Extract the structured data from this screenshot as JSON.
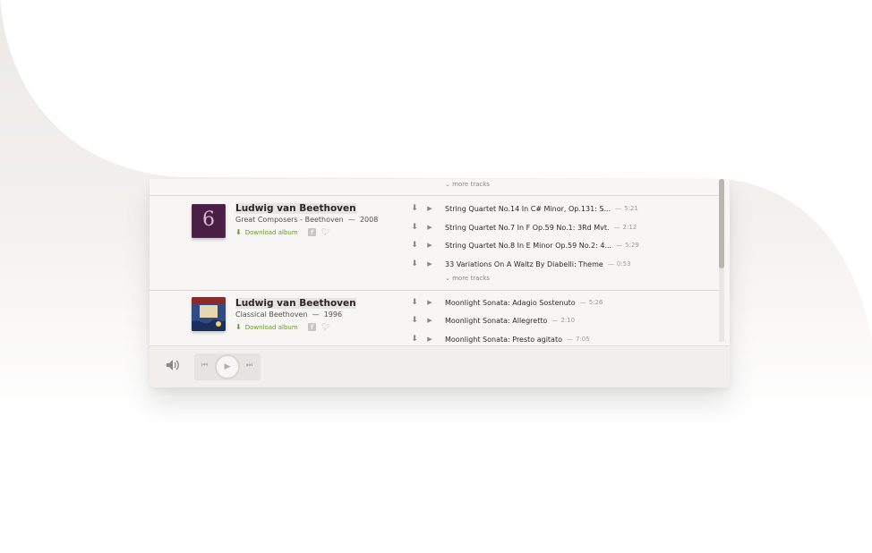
{
  "first_more_tracks": "more tracks",
  "albums": [
    {
      "artist": "Ludwig van Beethoven",
      "collection": "Great Composers - Beethoven",
      "separator": "—",
      "year": "2008",
      "cover_label": "6",
      "download_label": "Download album",
      "more_tracks": "more tracks",
      "tracks": [
        {
          "title": "String Quartet No.14 In C# Minor, Op.131: S...",
          "sep": "—",
          "duration": "5:21"
        },
        {
          "title": "String Quartet No.7 In F Op.59 No.1: 3Rd Mvt.",
          "sep": "—",
          "duration": "2:12"
        },
        {
          "title": "String Quartet No.8 In E Minor Op.59 No.2: 4...",
          "sep": "—",
          "duration": "5:29"
        },
        {
          "title": "33 Variations On A Waltz By Diabelli: Theme",
          "sep": "—",
          "duration": "0:53"
        }
      ]
    },
    {
      "artist": "Ludwig van Beethoven",
      "collection": "Classical Beethoven",
      "separator": "—",
      "year": "1996",
      "download_label": "Download album",
      "tracks": [
        {
          "title": "Moonlight Sonata: Adagio Sostenuto",
          "sep": "—",
          "duration": "5:26"
        },
        {
          "title": "Moonlight Sonata: Allegretto",
          "sep": "—",
          "duration": "2:10"
        },
        {
          "title": "Moonlight Sonata: Presto agitato",
          "sep": "—",
          "duration": "7:05"
        }
      ]
    }
  ],
  "icons": {
    "chevron": "⌄",
    "download": "⬇",
    "play": "▶",
    "prev": "⏮",
    "next": "⏭",
    "volume": "🔊"
  },
  "colors": {
    "accent_green": "#6a9a2e",
    "cover_purple": "#4a1f45"
  }
}
